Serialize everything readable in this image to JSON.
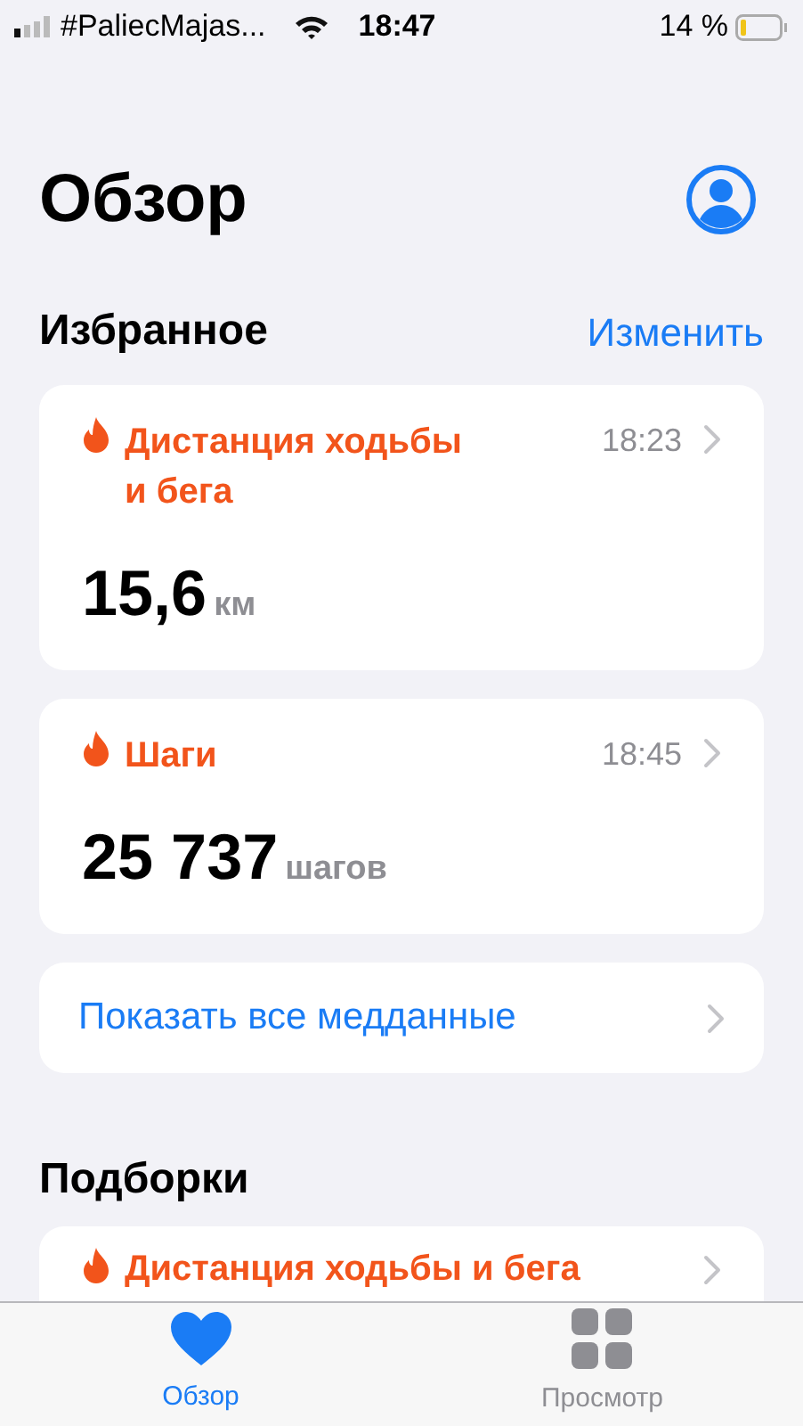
{
  "status_bar": {
    "carrier": "#PaliecMajas...",
    "time": "18:47",
    "battery": "14 %"
  },
  "title": "Обзор",
  "favorites": {
    "title": "Избранное",
    "edit": "Изменить",
    "items": [
      {
        "title": "Дистанция ходьбы и бега",
        "time": "18:23",
        "value": "15,6",
        "unit": "км"
      },
      {
        "title": "Шаги",
        "time": "18:45",
        "value": "25 737",
        "unit": "шагов"
      }
    ],
    "show_all": "Показать все медданные"
  },
  "highlights": {
    "title": "Подборки",
    "items": [
      {
        "title": "Дистанция ходьбы и бега"
      }
    ]
  },
  "tabs": [
    {
      "label": "Обзор",
      "selected": true,
      "kind": "heart"
    },
    {
      "label": "Просмотр",
      "selected": false,
      "kind": "grid"
    }
  ]
}
